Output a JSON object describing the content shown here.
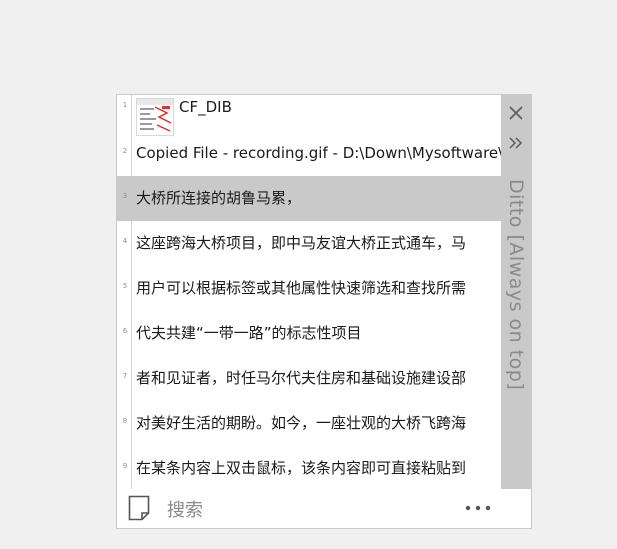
{
  "window": {
    "title": "Ditto [Always on top]"
  },
  "items": [
    {
      "num": "1",
      "text": "CF_DIB",
      "has_thumb": true
    },
    {
      "num": "2",
      "text": "Copied File - recording.gif - D:\\Down\\Mysoftware\\PixPin"
    },
    {
      "num": "3",
      "text": "大桥所连接的胡鲁马累，",
      "selected": true
    },
    {
      "num": "4",
      "text": "这座跨海大桥项目，即中马友谊大桥正式通车，马"
    },
    {
      "num": "5",
      "text": "用户可以根据标签或其他属性快速筛选和查找所需"
    },
    {
      "num": "6",
      "text": "代夫共建“一带一路”的标志性项目"
    },
    {
      "num": "7",
      "text": "者和见证者，时任马尔代夫住房和基础设施建设部"
    },
    {
      "num": "8",
      "text": "对美好生活的期盼。如今，一座壮观的大桥飞跨海"
    },
    {
      "num": "9",
      "text": "在某条内容上双击鼠标，该条内容即可直接粘贴到"
    }
  ],
  "search": {
    "placeholder": "搜索",
    "value": ""
  },
  "icons": {
    "close": "close-icon",
    "expand": "double-chevron-right-icon",
    "note": "note-icon",
    "more": "more-icon"
  },
  "colors": {
    "selected_row": "#c9c9c9",
    "sidebar": "#c9c9c9"
  }
}
